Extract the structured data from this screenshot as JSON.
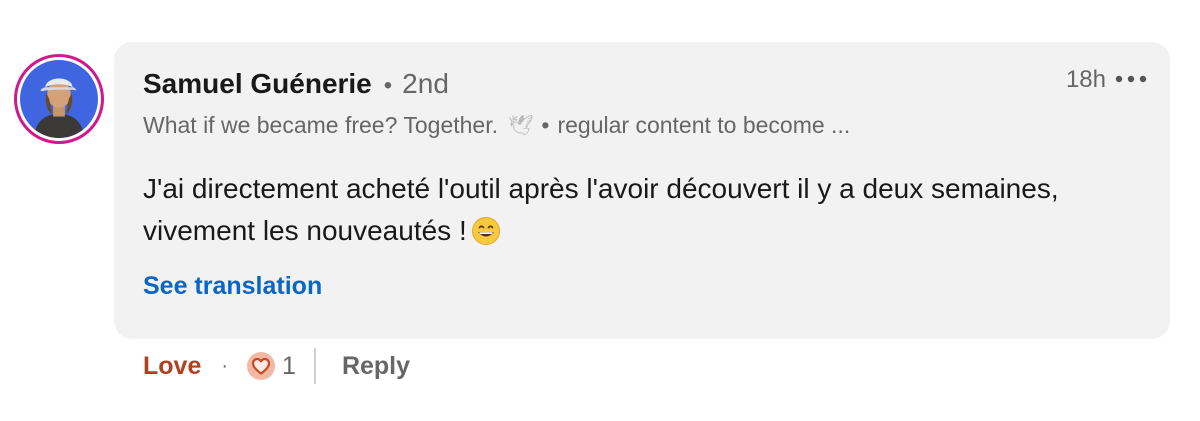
{
  "comment": {
    "author_name": "Samuel Guénerie",
    "separator": "•",
    "connection_degree": "2nd",
    "headline_start": "What if we became free? Together.",
    "headline_dove": "🕊",
    "headline_separator": "•",
    "headline_end": "regular content to become ...",
    "timestamp": "18h",
    "more_icon": "more-horizontal-icon",
    "text": "J'ai directement acheté l'outil après l'avoir découvert il y a deux semaines, vivement les nouveautés !",
    "text_emoji": "😄",
    "see_translation_label": "See translation"
  },
  "actions": {
    "reaction_label": "Love",
    "separator": "·",
    "reaction_icon": "heart-reaction-icon",
    "reaction_count": "1",
    "reply_label": "Reply"
  },
  "colors": {
    "avatar_ring": "#d0198a",
    "avatar_bg": "#3f66e0",
    "bubble_bg": "#f2f2f2",
    "link_blue": "#0a66c2",
    "love_red": "#b24020",
    "heart_fill": "#f3b8a3",
    "heart_stroke": "#c14a24",
    "text_secondary": "#666666"
  }
}
